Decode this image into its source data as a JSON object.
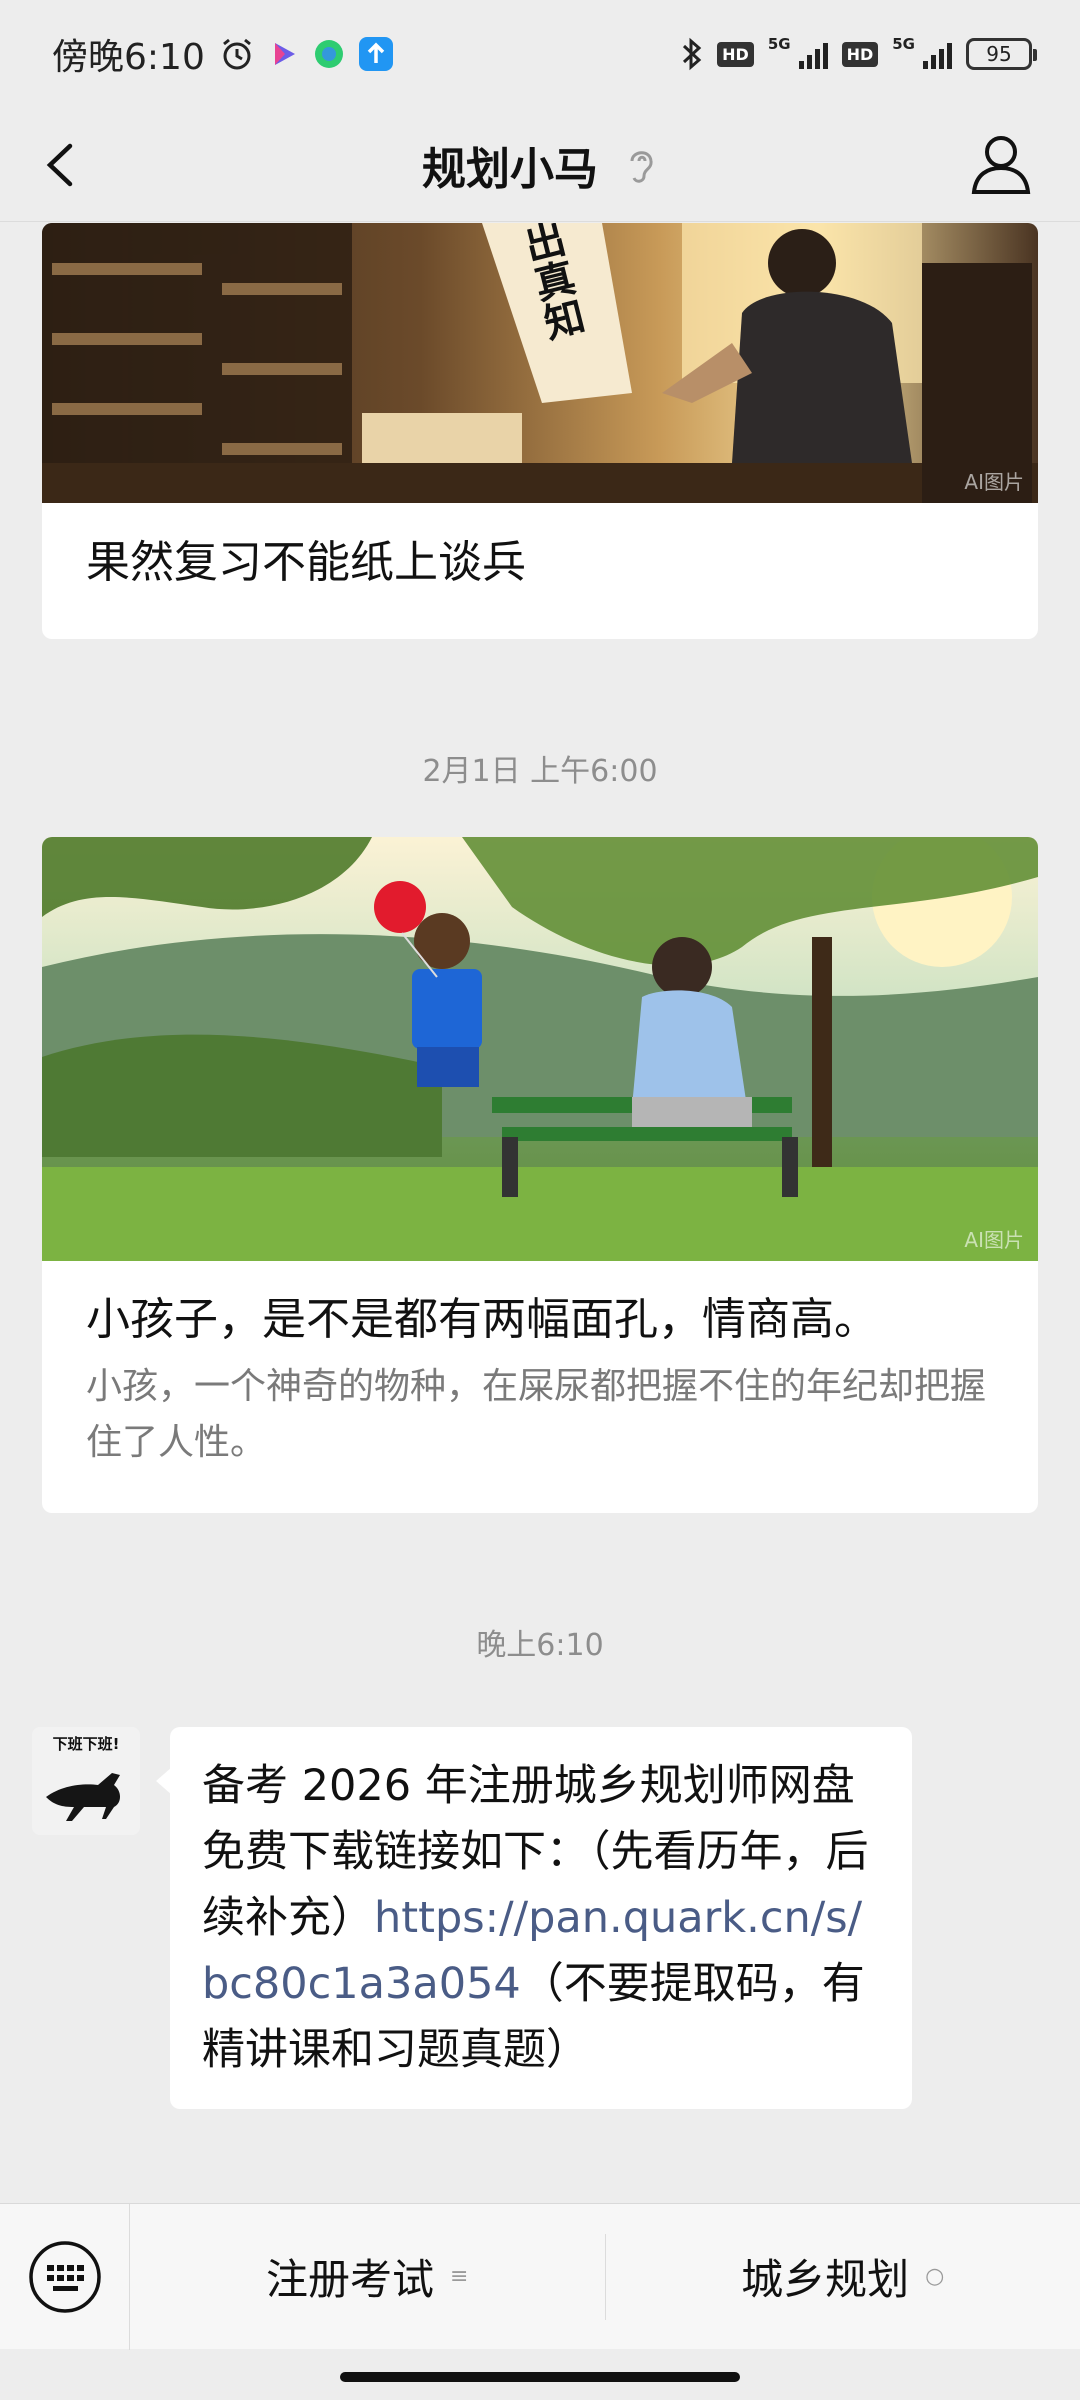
{
  "status_bar": {
    "time": "傍晚6:10",
    "battery": "95",
    "net1": "5G",
    "net2": "5G",
    "hd": "HD"
  },
  "nav": {
    "title": "规划小马"
  },
  "chat": {
    "card1": {
      "banner_text": "出真知",
      "ai_tag": "AI图片",
      "title": "果然复习不能纸上谈兵"
    },
    "timestamp1": "2月1日 上午6:00",
    "card2": {
      "ai_tag": "AI图片",
      "title": "小孩子，是不是都有两幅面孔，情商高。",
      "description": "小孩，一个神奇的物种，在屎尿都把握不住的年纪却把握住了人性。"
    },
    "timestamp2": "晚上6:10",
    "message": {
      "avatar_caption": "下班下班!",
      "text_before": "备考 2026 年注册城乡规划师网盘免费下载链接如下：（先看历年，后续补充）",
      "link": "https://pan.quark.cn/s/bc80c1a3a054",
      "text_after": "（不要提取码，有精讲课和习题真题）"
    }
  },
  "bottom_menu": {
    "items": [
      {
        "label": "注册考试",
        "glyph": "≡"
      },
      {
        "label": "城乡规划",
        "glyph": "○"
      }
    ]
  },
  "colors": {
    "background": "#ededed",
    "link": "#4a5c86",
    "card": "#ffffff"
  }
}
